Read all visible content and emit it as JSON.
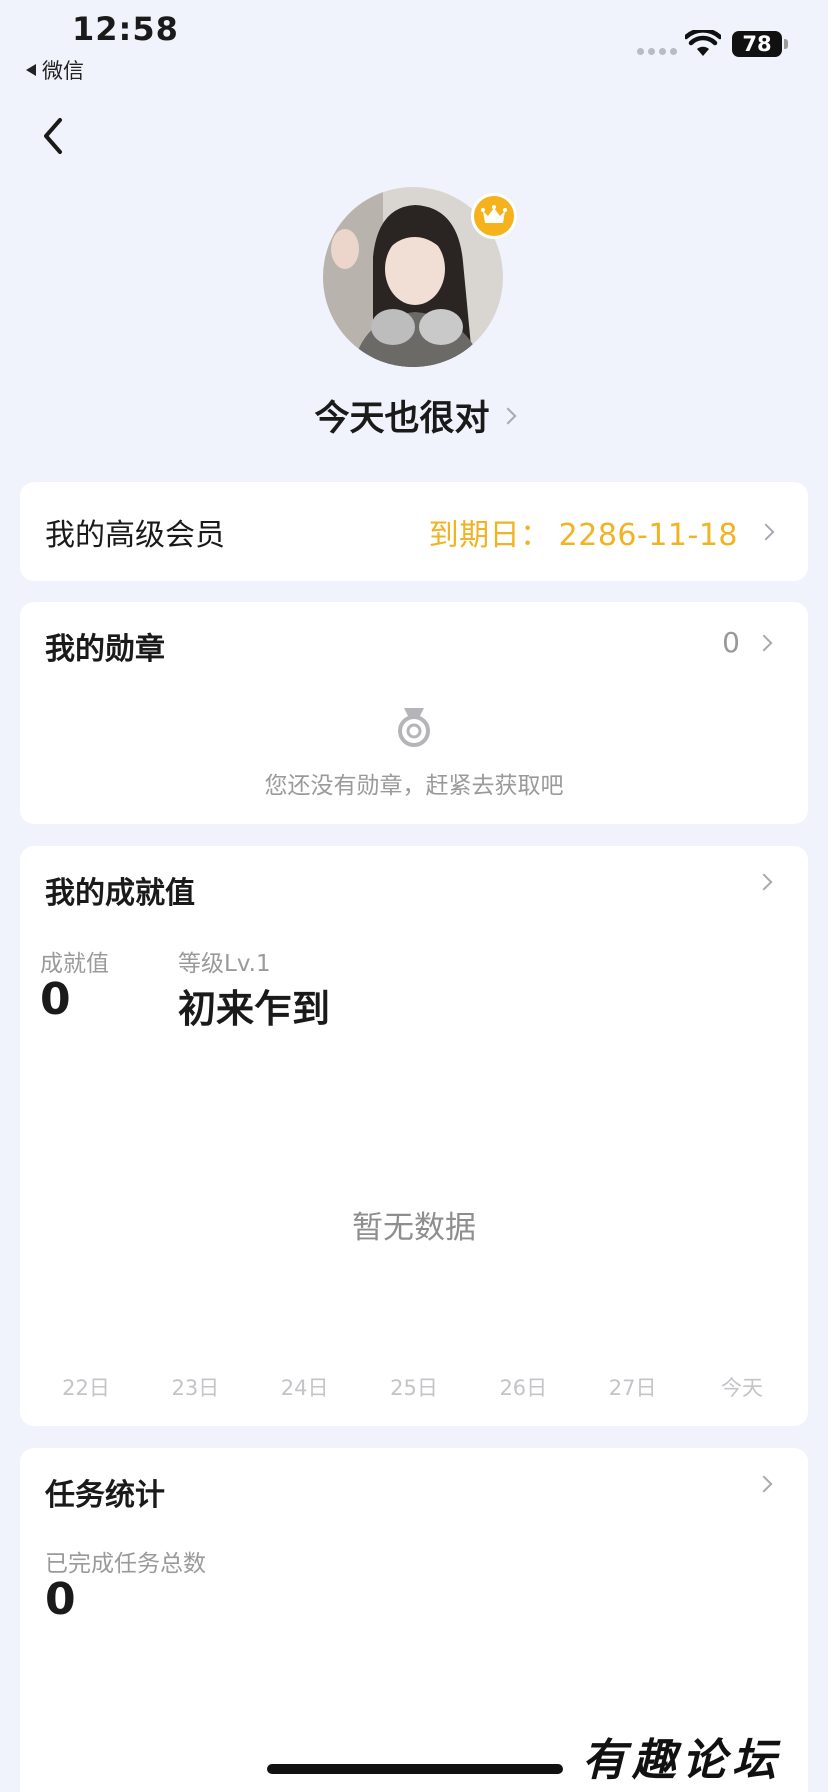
{
  "status_bar": {
    "time": "12:58",
    "back_app": "微信",
    "battery": "78"
  },
  "profile": {
    "nickname": "今天也很对"
  },
  "vip": {
    "label": "我的高级会员",
    "expire_label": "到期日：",
    "expire_date": "2286-11-18"
  },
  "medals": {
    "title": "我的勋章",
    "count": "0",
    "empty_text": "您还没有勋章，赶紧去获取吧"
  },
  "achievement": {
    "title": "我的成就值",
    "value_label": "成就值",
    "value": "0",
    "level_label": "等级Lv.1",
    "level_name": "初来乍到",
    "no_data": "暂无数据",
    "days": [
      "22日",
      "23日",
      "24日",
      "25日",
      "26日",
      "27日",
      "今天"
    ]
  },
  "tasks": {
    "title": "任务统计",
    "completed_label": "已完成任务总数",
    "completed_value": "0"
  },
  "watermark": "有趣论坛",
  "colors": {
    "background": "#F0F2FC",
    "vip_gold": "#F2B323",
    "crown_badge": "#F6B21C"
  },
  "icons": [
    "back-arrow-icon",
    "wifi-icon",
    "crown-icon",
    "chevron-right-icon",
    "medal-icon"
  ]
}
